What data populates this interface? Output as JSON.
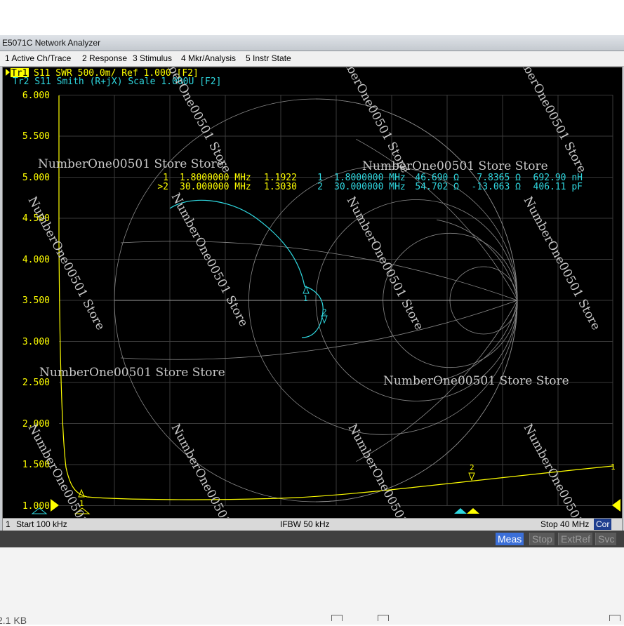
{
  "window": {
    "title": "E5071C Network Analyzer"
  },
  "menu": [
    "1 Active Ch/Trace",
    "2 Response",
    "3 Stimulus",
    "4 Mkr/Analysis",
    "5 Instr State"
  ],
  "traces": {
    "tr1_tag": "Tr1",
    "tr1_text": "S11 SWR 500.0m/ Ref 1.000 [F2]",
    "tr2_text": "Tr2 S11 Smith (R+jX) Scale 1.000U [F2]",
    "tr1_color": "#ffff00",
    "tr2_color": "#2fd8e0"
  },
  "y_axis": [
    "6.000",
    "5.500",
    "5.000",
    "4.500",
    "4.000",
    "3.500",
    "3.000",
    "2.500",
    "2.000",
    "1.500",
    "1.000"
  ],
  "markers": {
    "swr": [
      {
        "marker": "1",
        "freq": "1.8000000 MHz",
        "value": "1.1922"
      },
      {
        "marker": ">2",
        "freq": "30.000000 MHz",
        "value": "1.3030"
      }
    ],
    "smith": [
      {
        "marker": "1",
        "freq": "1.8000000 MHz",
        "r": "46.690 Ω",
        "x": "7.8365 Ω",
        "lc": "692.90 nH"
      },
      {
        "marker": "2",
        "freq": "30.000000 MHz",
        "r": "54.702 Ω",
        "x": "-13.063 Ω",
        "lc": "406.11 pF"
      }
    ],
    "smith_labels": [
      "1",
      "2"
    ],
    "swr_labels": [
      "1",
      "2",
      "1"
    ]
  },
  "status": {
    "channel": "1",
    "start": "Start 100 kHz",
    "ifbw": "IFBW 50 kHz",
    "stop": "Stop 40 MHz",
    "cor": "Cor"
  },
  "softkeys": {
    "meas": "Meas",
    "stop": "Stop",
    "ext_ref": "ExtRef",
    "svc": "Svc"
  },
  "watermarks": [
    "NumberOne00501 Store Store",
    "NumberOne00501 Store"
  ],
  "below": {
    "size": "2.1 KB"
  }
}
